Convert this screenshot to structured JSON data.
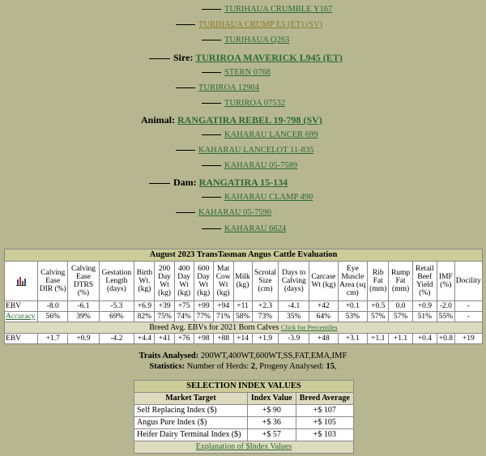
{
  "pedigree": {
    "ggs1": "TURIHAUA CRUMBLE Y167",
    "gs1": "TURIHAUA CRUMP E5 (ET) (SV)",
    "ggd1": "TURIHAUA Q263",
    "sire_label": "Sire:",
    "sire": "TURIROA MAVERICK L945 (ET)",
    "ggs2": "STERN 0768",
    "gd1": "TURIROA 12904",
    "ggd2": "TURIROA 07532",
    "animal_label": "Animal:",
    "animal": "RANGATIRA REBEL 19-798 (SV)",
    "ggs3": "KAHARAU LANCER 699",
    "gs2": "KAHARAU LANCELOT 11-835",
    "ggd3": "KAHARAU 05-7589",
    "dam_label": "Dam:",
    "dam": "RANGATIRA 15-134",
    "ggs4": "KAHARAU CLAMP 490",
    "gd2": "KAHARAU 05-7590",
    "ggd4": "KAHARAU 6624"
  },
  "ebv_table": {
    "title": "August 2023 TransTasman Angus Cattle Evaluation",
    "headers": [
      "Calving Ease DIR (%)",
      "Calving Ease DTRS (%)",
      "Gestation Length (days)",
      "Birth Wt. (kg)",
      "200 Day Wt (kg)",
      "400 Day Wt (kg)",
      "600 Day Wt (kg)",
      "Mat Cow Wt (kg)",
      "Milk (kg)",
      "Scrotal Size (cm)",
      "Days to Calving (days)",
      "Carcase Wt (kg)",
      "Eye Muscle Area (sq cm)",
      "Rib Fat (mm)",
      "Rump Fat (mm)",
      "Retail Beef Yield (%)",
      "IMF (%)",
      "Docility"
    ],
    "ebv_label": "EBV",
    "ebv": [
      "-8.0",
      "-6.1",
      "-5.3",
      "+6.9",
      "+39",
      "+75",
      "+99",
      "+94",
      "+11",
      "+2.3",
      "-4.1",
      "+42",
      "+0.1",
      "+0.5",
      "0.0",
      "+0.9",
      "-2.0",
      "-"
    ],
    "acc_label": "Accuracy",
    "accuracy": [
      "56%",
      "39%",
      "69%",
      "82%",
      "75%",
      "74%",
      "77%",
      "71%",
      "58%",
      "73%",
      "35%",
      "64%",
      "53%",
      "57%",
      "57%",
      "51%",
      "55%",
      "-"
    ],
    "breed_avg_label": "Breed Avg. EBVs for 2021 Born Calves",
    "percentiles_link": "Click for Percentiles",
    "breed_label": "EBV",
    "breed": [
      "+1.7",
      "+0.9",
      "-4.2",
      "+4.4",
      "+41",
      "+76",
      "+98",
      "+88",
      "+14",
      "+1.9",
      "-3.9",
      "+48",
      "+3.1",
      "+1.1",
      "+1.1",
      "+0.4",
      "+0.8",
      "+19"
    ]
  },
  "traits": {
    "label": "Traits Analysed:",
    "value": "200WT,400WT,600WT,SS,FAT,EMA,IMF",
    "stats_label": "Statistics:",
    "herds_label": "Number of Herds:",
    "herds": "2",
    "progeny_label": "Progeny Analysed:",
    "progeny": "15"
  },
  "index_table": {
    "title": "SELECTION INDEX VALUES",
    "col_market": "Market Target",
    "col_index": "Index Value",
    "col_breed": "Breed Average",
    "rows": [
      {
        "name": "Self Replacing Index ($)",
        "value": "+$ 90",
        "avg": "+$ 107"
      },
      {
        "name": "Angus Pure Index ($)",
        "value": "+$ 36",
        "avg": "+$ 105"
      },
      {
        "name": "Heifer Dairy Terminal Index ($)",
        "value": "+$ 57",
        "avg": "+$ 103"
      }
    ],
    "footer_link": "Explanation of $Index Values"
  },
  "colors": {
    "background": "#b6b791",
    "link": "#2a6a32",
    "header": "#cccc99"
  }
}
